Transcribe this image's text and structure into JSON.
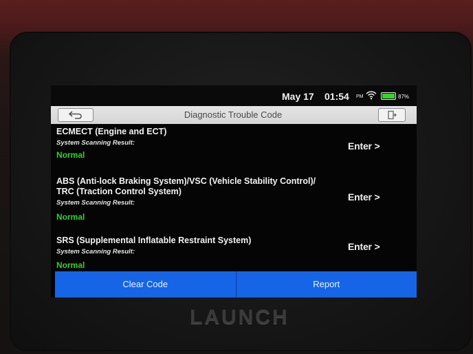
{
  "status": {
    "date": "May 17",
    "time": "01:54",
    "ampm": "PM",
    "battery": "87%"
  },
  "header": {
    "title": "Diagnostic Trouble Code"
  },
  "systems": [
    {
      "name_lines": [
        "ECMECT (Engine and ECT)"
      ],
      "result_label": "System Scanning Result:",
      "result": "Normal",
      "enter_label": "Enter >"
    },
    {
      "name_lines": [
        "ABS (Anti-lock Braking System)/VSC (Vehicle Stability Control)/",
        "TRC (Traction Control System)"
      ],
      "result_label": "System Scanning Result:",
      "result": "Normal",
      "enter_label": "Enter >"
    },
    {
      "name_lines": [
        "SRS (Supplemental Inflatable Restraint System)"
      ],
      "result_label": "System Scanning Result:",
      "result": "Normal",
      "enter_label": "Enter >"
    }
  ],
  "footer": {
    "clear_label": "Clear Code",
    "report_label": "Report"
  },
  "device": {
    "brand": "LAUNCH"
  },
  "colors": {
    "accent": "#1565e6",
    "normal": "#2bd62b"
  },
  "icons": {
    "back": "back-arrow-icon",
    "exit": "exit-icon",
    "wifi": "wifi-icon",
    "battery": "battery-icon"
  }
}
